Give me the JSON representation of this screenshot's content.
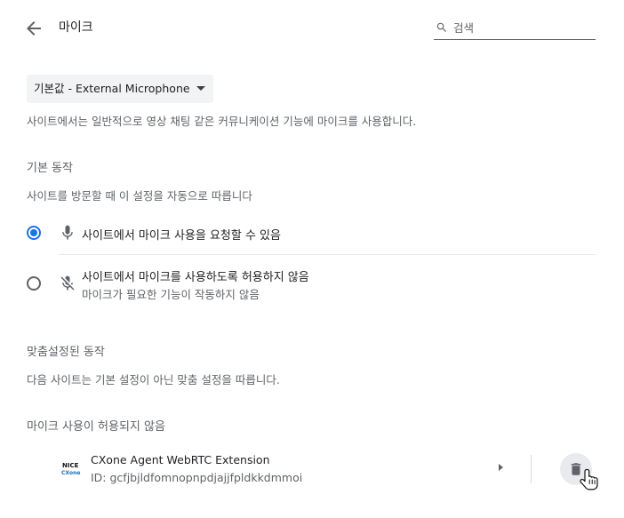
{
  "header": {
    "back_icon": "arrow-back-icon",
    "title": "마이크",
    "search_icon": "search-icon",
    "search_placeholder": "검색",
    "search_value": ""
  },
  "device": {
    "selected": "기본값 - External Microphone"
  },
  "intro_text": "사이트에서는 일반적으로 영상 채팅 같은 커뮤니케이션 기능에 마이크를 사용합니다.",
  "default_behavior": {
    "heading": "기본 동작",
    "description": "사이트를 방문할 때 이 설정을 자동으로 따릅니다",
    "options": [
      {
        "label": "사이트에서 마이크 사용을 요청할 수 있음",
        "sublabel": "",
        "icon": "mic-icon",
        "checked": true
      },
      {
        "label": "사이트에서 마이크를 사용하도록 허용하지 않음",
        "sublabel": "마이크가 필요한 기능이 작동하지 않음",
        "icon": "mic-off-icon",
        "checked": false
      }
    ]
  },
  "custom_behavior": {
    "heading": "맞춤설정된 동작",
    "description": "다음 사이트는 기본 설정이 아닌 맞춤 설정을 따릅니다.",
    "blocked_heading": "마이크 사용이 허용되지 않음",
    "blocked_sites": [
      {
        "name": "CXone Agent WebRTC Extension",
        "id": "ID: gcfjbjldfomnopnpdjajjfpldkkdmmoi",
        "logo_text_top": "NICE",
        "logo_text_bottom": "CXone",
        "delete_icon": "trash-icon"
      }
    ]
  },
  "colors": {
    "accent": "#1a73e8",
    "text_primary": "#202124",
    "text_secondary": "#5f6368"
  }
}
